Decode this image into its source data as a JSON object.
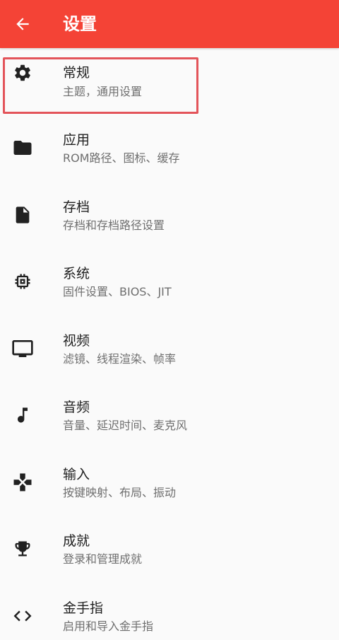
{
  "appbar": {
    "title": "设置",
    "back_icon": "arrow-back-icon",
    "color": "#f44336"
  },
  "items": [
    {
      "id": "general",
      "icon": "gear-icon",
      "title": "常规",
      "subtitle": "主题，通用设置"
    },
    {
      "id": "app",
      "icon": "folder-icon",
      "title": "应用",
      "subtitle": "ROM路径、图标、缓存"
    },
    {
      "id": "saves",
      "icon": "file-icon",
      "title": "存档",
      "subtitle": "存档和存档路径设置"
    },
    {
      "id": "system",
      "icon": "chip-icon",
      "title": "系统",
      "subtitle": "固件设置、BIOS、JIT"
    },
    {
      "id": "video",
      "icon": "monitor-icon",
      "title": "视频",
      "subtitle": "滤镜、线程渲染、帧率"
    },
    {
      "id": "audio",
      "icon": "music-note-icon",
      "title": "音频",
      "subtitle": "音量、延迟时间、麦克风"
    },
    {
      "id": "input",
      "icon": "gamepad-icon",
      "title": "输入",
      "subtitle": "按键映射、布局、振动"
    },
    {
      "id": "achievements",
      "icon": "trophy-icon",
      "title": "成就",
      "subtitle": "登录和管理成就"
    },
    {
      "id": "cheats",
      "icon": "code-icon",
      "title": "金手指",
      "subtitle": "启用和导入金手指"
    }
  ],
  "highlight_color": "#e3545a"
}
